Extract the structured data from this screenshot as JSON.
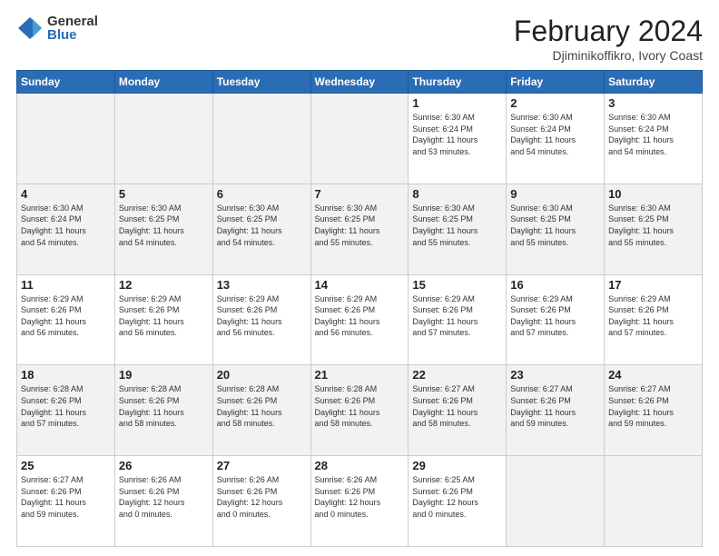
{
  "logo": {
    "general": "General",
    "blue": "Blue"
  },
  "title": "February 2024",
  "subtitle": "Djiminikoffikro, Ivory Coast",
  "days_header": [
    "Sunday",
    "Monday",
    "Tuesday",
    "Wednesday",
    "Thursday",
    "Friday",
    "Saturday"
  ],
  "weeks": [
    [
      {
        "day": "",
        "info": ""
      },
      {
        "day": "",
        "info": ""
      },
      {
        "day": "",
        "info": ""
      },
      {
        "day": "",
        "info": ""
      },
      {
        "day": "1",
        "info": "Sunrise: 6:30 AM\nSunset: 6:24 PM\nDaylight: 11 hours\nand 53 minutes."
      },
      {
        "day": "2",
        "info": "Sunrise: 6:30 AM\nSunset: 6:24 PM\nDaylight: 11 hours\nand 54 minutes."
      },
      {
        "day": "3",
        "info": "Sunrise: 6:30 AM\nSunset: 6:24 PM\nDaylight: 11 hours\nand 54 minutes."
      }
    ],
    [
      {
        "day": "4",
        "info": "Sunrise: 6:30 AM\nSunset: 6:24 PM\nDaylight: 11 hours\nand 54 minutes."
      },
      {
        "day": "5",
        "info": "Sunrise: 6:30 AM\nSunset: 6:25 PM\nDaylight: 11 hours\nand 54 minutes."
      },
      {
        "day": "6",
        "info": "Sunrise: 6:30 AM\nSunset: 6:25 PM\nDaylight: 11 hours\nand 54 minutes."
      },
      {
        "day": "7",
        "info": "Sunrise: 6:30 AM\nSunset: 6:25 PM\nDaylight: 11 hours\nand 55 minutes."
      },
      {
        "day": "8",
        "info": "Sunrise: 6:30 AM\nSunset: 6:25 PM\nDaylight: 11 hours\nand 55 minutes."
      },
      {
        "day": "9",
        "info": "Sunrise: 6:30 AM\nSunset: 6:25 PM\nDaylight: 11 hours\nand 55 minutes."
      },
      {
        "day": "10",
        "info": "Sunrise: 6:30 AM\nSunset: 6:25 PM\nDaylight: 11 hours\nand 55 minutes."
      }
    ],
    [
      {
        "day": "11",
        "info": "Sunrise: 6:29 AM\nSunset: 6:26 PM\nDaylight: 11 hours\nand 56 minutes."
      },
      {
        "day": "12",
        "info": "Sunrise: 6:29 AM\nSunset: 6:26 PM\nDaylight: 11 hours\nand 56 minutes."
      },
      {
        "day": "13",
        "info": "Sunrise: 6:29 AM\nSunset: 6:26 PM\nDaylight: 11 hours\nand 56 minutes."
      },
      {
        "day": "14",
        "info": "Sunrise: 6:29 AM\nSunset: 6:26 PM\nDaylight: 11 hours\nand 56 minutes."
      },
      {
        "day": "15",
        "info": "Sunrise: 6:29 AM\nSunset: 6:26 PM\nDaylight: 11 hours\nand 57 minutes."
      },
      {
        "day": "16",
        "info": "Sunrise: 6:29 AM\nSunset: 6:26 PM\nDaylight: 11 hours\nand 57 minutes."
      },
      {
        "day": "17",
        "info": "Sunrise: 6:29 AM\nSunset: 6:26 PM\nDaylight: 11 hours\nand 57 minutes."
      }
    ],
    [
      {
        "day": "18",
        "info": "Sunrise: 6:28 AM\nSunset: 6:26 PM\nDaylight: 11 hours\nand 57 minutes."
      },
      {
        "day": "19",
        "info": "Sunrise: 6:28 AM\nSunset: 6:26 PM\nDaylight: 11 hours\nand 58 minutes."
      },
      {
        "day": "20",
        "info": "Sunrise: 6:28 AM\nSunset: 6:26 PM\nDaylight: 11 hours\nand 58 minutes."
      },
      {
        "day": "21",
        "info": "Sunrise: 6:28 AM\nSunset: 6:26 PM\nDaylight: 11 hours\nand 58 minutes."
      },
      {
        "day": "22",
        "info": "Sunrise: 6:27 AM\nSunset: 6:26 PM\nDaylight: 11 hours\nand 58 minutes."
      },
      {
        "day": "23",
        "info": "Sunrise: 6:27 AM\nSunset: 6:26 PM\nDaylight: 11 hours\nand 59 minutes."
      },
      {
        "day": "24",
        "info": "Sunrise: 6:27 AM\nSunset: 6:26 PM\nDaylight: 11 hours\nand 59 minutes."
      }
    ],
    [
      {
        "day": "25",
        "info": "Sunrise: 6:27 AM\nSunset: 6:26 PM\nDaylight: 11 hours\nand 59 minutes."
      },
      {
        "day": "26",
        "info": "Sunrise: 6:26 AM\nSunset: 6:26 PM\nDaylight: 12 hours\nand 0 minutes."
      },
      {
        "day": "27",
        "info": "Sunrise: 6:26 AM\nSunset: 6:26 PM\nDaylight: 12 hours\nand 0 minutes."
      },
      {
        "day": "28",
        "info": "Sunrise: 6:26 AM\nSunset: 6:26 PM\nDaylight: 12 hours\nand 0 minutes."
      },
      {
        "day": "29",
        "info": "Sunrise: 6:25 AM\nSunset: 6:26 PM\nDaylight: 12 hours\nand 0 minutes."
      },
      {
        "day": "",
        "info": ""
      },
      {
        "day": "",
        "info": ""
      }
    ]
  ]
}
